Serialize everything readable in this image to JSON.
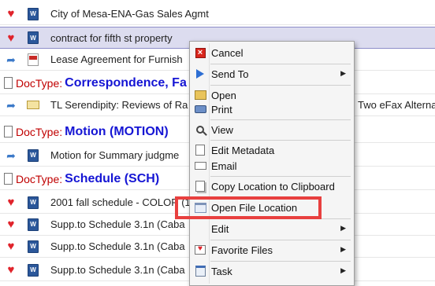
{
  "rows": [
    {
      "text": "City of Mesa-ENA-Gas Sales Agmt",
      "icon1": "heart-icon",
      "icon2": "word-doc-icon"
    },
    {
      "text": "contract for fifth st property",
      "icon1": "heart-icon",
      "icon2": "word-doc-icon",
      "selected": true
    },
    {
      "text": "Lease Agreement for Furnish",
      "icon1": "forward-arrow-icon",
      "icon2": "pdf-icon"
    },
    {
      "text": "TL Serendipity: Reviews of Ra",
      "icon1": "forward-arrow-icon",
      "icon2": "envelope-icon"
    },
    {
      "text": "Motion for Summary judgme",
      "icon1": "forward-arrow-icon",
      "icon2": "word-doc-icon"
    },
    {
      "text": "2001 fall schedule - COLOR (1",
      "icon1": "heart-icon",
      "icon2": "word-doc-icon"
    },
    {
      "text": "Supp.to Schedule 3.1n (Caba",
      "icon1": "heart-icon",
      "icon2": "word-doc-icon"
    },
    {
      "text": "Supp.to Schedule 3.1n (Caba",
      "icon1": "heart-icon",
      "icon2": "word-doc-icon"
    },
    {
      "text": "Supp.to Schedule 3.1n (Caba",
      "icon1": "heart-icon",
      "icon2": "word-doc-icon"
    }
  ],
  "row_tail": "Two eFax Alterna",
  "groups": [
    {
      "label": "DocType:",
      "value": "Correspondence, Fa"
    },
    {
      "label": "DocType:",
      "value": "Motion  (MOTION)"
    },
    {
      "label": "DocType:",
      "value": "Schedule  (SCH)"
    }
  ],
  "menu": {
    "cancel": "Cancel",
    "send_to": "Send To",
    "open": "Open",
    "print": "Print",
    "view": "View",
    "edit_metadata": "Edit Metadata",
    "email": "Email",
    "copy_location": "Copy Location to Clipboard",
    "open_file_location": "Open File Location",
    "edit": "Edit",
    "favorite_files": "Favorite Files",
    "task": "Task"
  },
  "colors": {
    "doctype_label": "#c00000",
    "doctype_value": "#1515d4",
    "highlight": "#e8403f",
    "heart": "#e0232b"
  }
}
